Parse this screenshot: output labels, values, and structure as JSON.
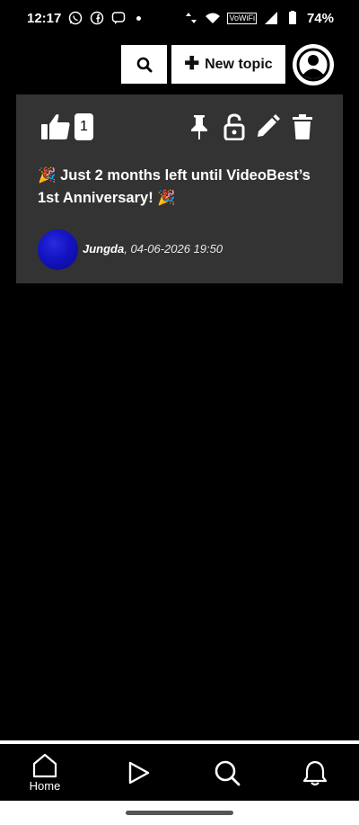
{
  "status_bar": {
    "time": "12:17",
    "battery": "74%",
    "vowifi": "VoWiFi"
  },
  "toolbar": {
    "new_topic_label": "New topic"
  },
  "topic": {
    "like_count": "1",
    "title": "🎉 Just 2 months left until VideoBest’s 1st Anniversary! 🎉",
    "author": "Jungda",
    "date": ", 04-06-2026 19:50"
  },
  "bottom_nav": {
    "home_label": "Home"
  },
  "colors": {
    "background": "#000000",
    "card": "#333333",
    "avatar": "#1313c2"
  }
}
